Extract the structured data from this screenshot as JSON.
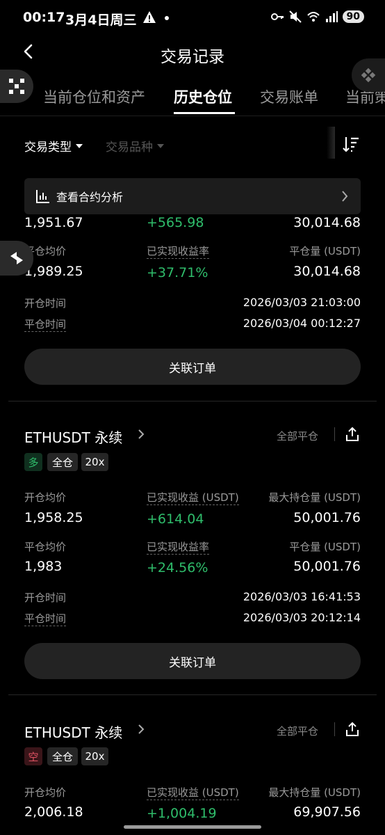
{
  "status_bar": {
    "time": "00:17",
    "date": "3月4日周三",
    "battery": "90"
  },
  "header": {
    "title": "交易记录"
  },
  "tabs": [
    {
      "label": "当前仓位和资产"
    },
    {
      "label": "历史仓位"
    },
    {
      "label": "交易账单"
    },
    {
      "label": "当前策"
    }
  ],
  "filters": {
    "type": "交易类型",
    "instrument": "交易品种"
  },
  "banner": {
    "label": "查看合约分析"
  },
  "card0": {
    "open_price": "1,951.67",
    "realized_pnl": "+565.98",
    "max_position": "30,014.68",
    "close_avg_label": "平仓均价",
    "close_avg": "1,989.25",
    "pnl_rate_label": "已实现收益率",
    "pnl_rate": "+37.71%",
    "close_amount_label": "平仓量 (USDT)",
    "close_amount": "30,014.68",
    "open_time_label": "开仓时间",
    "open_time": "2026/03/03 21:03:00",
    "close_time_label": "平仓时间",
    "close_time": "2026/03/04 00:12:27",
    "related_orders": "关联订单"
  },
  "card1": {
    "symbol": "ETHUSDT 永续",
    "status": "全部平仓",
    "side": "多",
    "margin_mode": "全仓",
    "leverage": "20x",
    "open_price_label": "开仓均价",
    "open_price": "1,958.25",
    "realized_pnl_label": "已实现收益 (USDT)",
    "realized_pnl": "+614.04",
    "max_position_label": "最大持仓量 (USDT)",
    "max_position": "50,001.76",
    "close_avg_label": "平仓均价",
    "close_avg": "1,983",
    "pnl_rate_label": "已实现收益率",
    "pnl_rate": "+24.56%",
    "close_amount_label": "平仓量 (USDT)",
    "close_amount": "50,001.76",
    "open_time_label": "开仓时间",
    "open_time": "2026/03/03 16:41:53",
    "close_time_label": "平仓时间",
    "close_time": "2026/03/03 20:12:14",
    "related_orders": "关联订单"
  },
  "card2": {
    "symbol": "ETHUSDT 永续",
    "status": "全部平仓",
    "side": "空",
    "margin_mode": "全仓",
    "leverage": "20x",
    "open_price_label": "开仓均价",
    "open_price": "2,006.18",
    "realized_pnl_label": "已实现收益 (USDT)",
    "realized_pnl": "+1,004.19",
    "max_position_label": "最大持仓量 (USDT)",
    "max_position": "69,907.56"
  },
  "colors": {
    "profit": "#2fbd6b",
    "short": "#e05263",
    "background": "#000000"
  }
}
